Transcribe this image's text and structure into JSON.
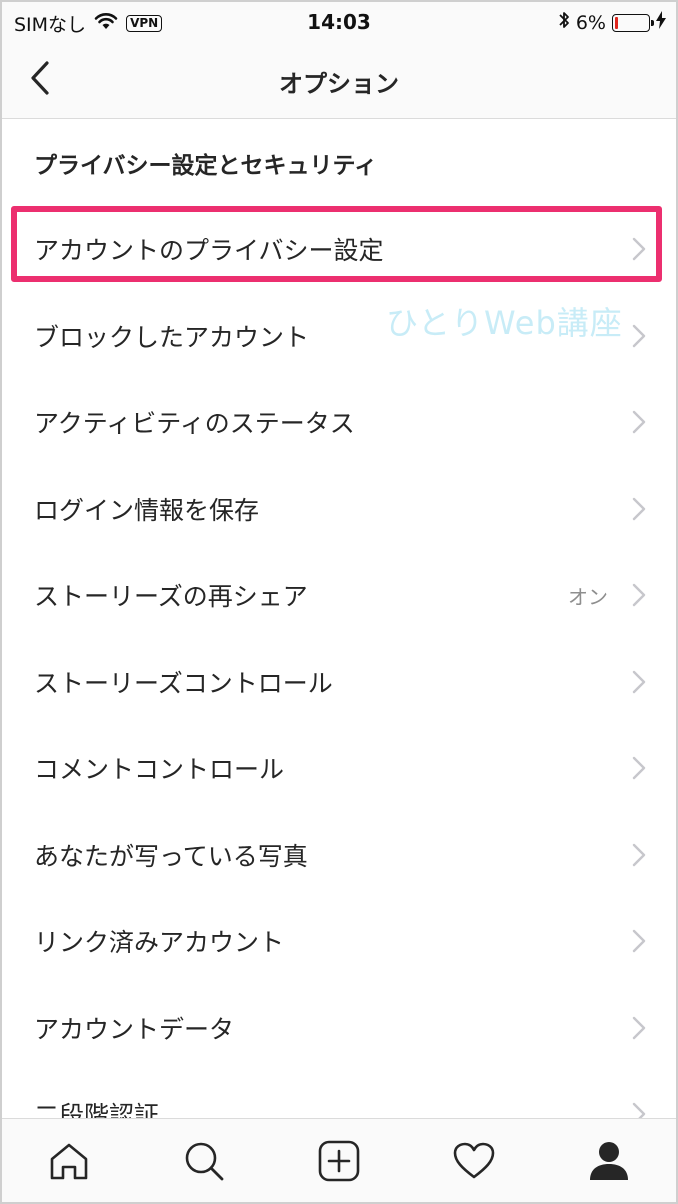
{
  "status_bar": {
    "carrier": "SIMなし",
    "vpn": "VPN",
    "time": "14:03",
    "battery_percent_label": "6%",
    "battery_level": 0.06,
    "battery_color": "#e0271f"
  },
  "nav": {
    "title": "オプション",
    "back_icon": "chevron-left-icon"
  },
  "section": {
    "header": "プライバシー設定とセキュリティ"
  },
  "items": [
    {
      "label": "アカウントのプライバシー設定",
      "value": ""
    },
    {
      "label": "ブロックしたアカウント",
      "value": ""
    },
    {
      "label": "アクティビティのステータス",
      "value": ""
    },
    {
      "label": "ログイン情報を保存",
      "value": ""
    },
    {
      "label": "ストーリーズの再シェア",
      "value": "オン"
    },
    {
      "label": "ストーリーズコントロール",
      "value": ""
    },
    {
      "label": "コメントコントロール",
      "value": ""
    },
    {
      "label": "あなたが写っている写真",
      "value": ""
    },
    {
      "label": "リンク済みアカウント",
      "value": ""
    },
    {
      "label": "アカウントデータ",
      "value": ""
    },
    {
      "label": "二段階認証",
      "value": ""
    }
  ],
  "watermark": "ひとりWeb講座",
  "highlight_color": "#ec2f6f",
  "tabs": [
    {
      "name": "home-icon"
    },
    {
      "name": "search-icon"
    },
    {
      "name": "add-post-icon"
    },
    {
      "name": "heart-icon"
    },
    {
      "name": "profile-icon"
    }
  ]
}
